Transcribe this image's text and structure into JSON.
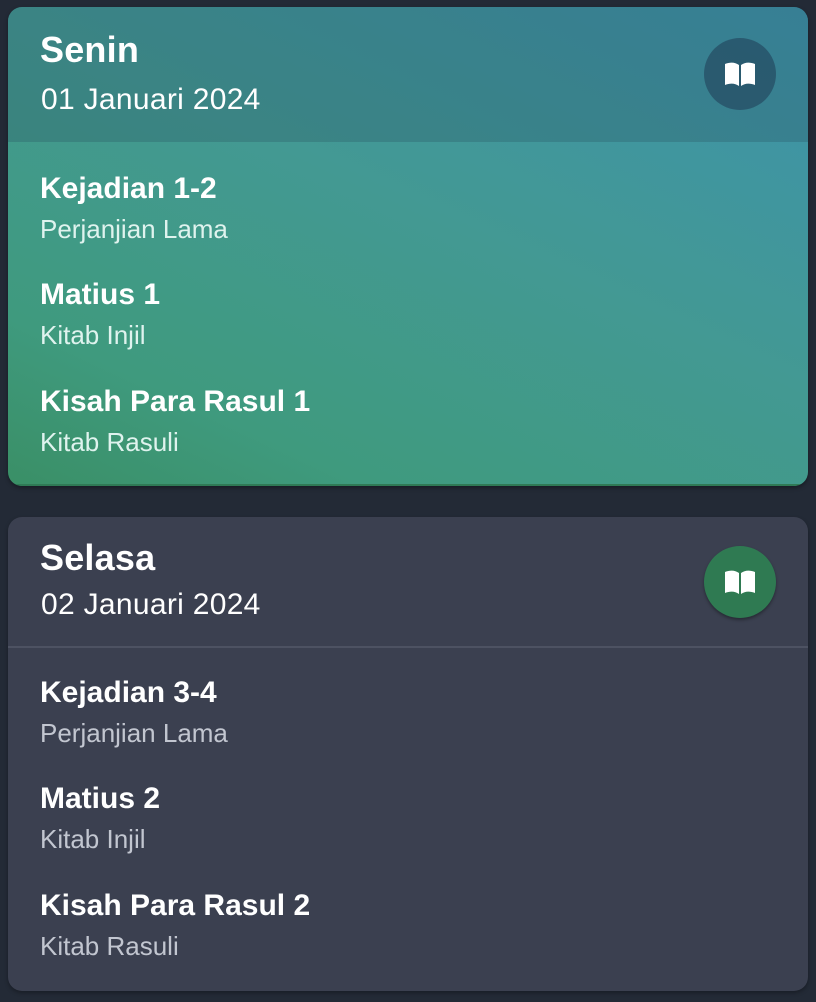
{
  "days": [
    {
      "day": "Senin",
      "date": "01 Januari 2024",
      "icon": "open-book-icon",
      "readings": [
        {
          "title": "Kejadian 1-2",
          "subtitle": "Perjanjian Lama"
        },
        {
          "title": "Matius 1",
          "subtitle": "Kitab Injil"
        },
        {
          "title": "Kisah Para Rasul 1",
          "subtitle": "Kitab Rasuli"
        }
      ]
    },
    {
      "day": "Selasa",
      "date": "02 Januari 2024",
      "icon": "open-book-icon",
      "readings": [
        {
          "title": "Kejadian 3-4",
          "subtitle": "Perjanjian Lama"
        },
        {
          "title": "Matius 2",
          "subtitle": "Kitab Injil"
        },
        {
          "title": "Kisah Para Rasul 2",
          "subtitle": "Kitab Rasuli"
        }
      ]
    }
  ],
  "colors": {
    "background": "#232a36",
    "active_card_start": "#3d92ab",
    "active_card_end": "#3a8f66",
    "card": "#3b4050",
    "accent_green": "#2f7a52"
  }
}
